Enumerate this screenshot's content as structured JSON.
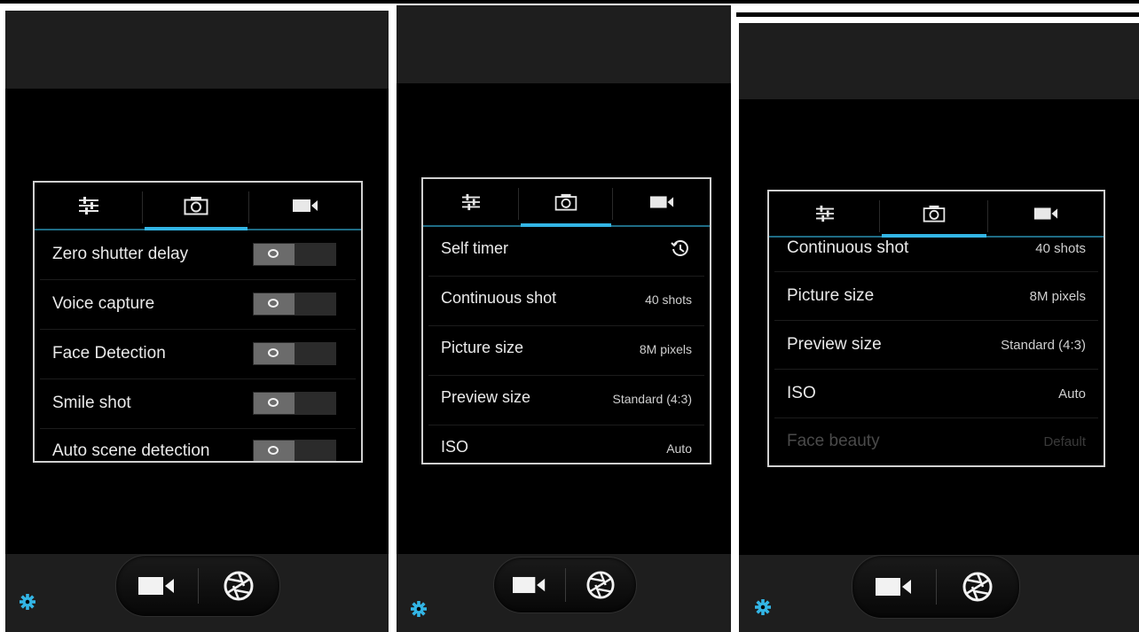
{
  "screens": [
    {
      "tabs": [
        {
          "icon": "settings-sliders-icon"
        },
        {
          "icon": "camera-icon"
        },
        {
          "icon": "video-camera-icon"
        }
      ],
      "active_tab": 1,
      "rows": [
        {
          "label": "Zero shutter delay",
          "toggle": "off"
        },
        {
          "label": "Voice capture",
          "toggle": "off"
        },
        {
          "label": "Face Detection",
          "toggle": "off"
        },
        {
          "label": "Smile shot",
          "toggle": "off"
        },
        {
          "label": "Auto scene detection",
          "toggle": "off"
        }
      ]
    },
    {
      "tabs": [
        {
          "icon": "settings-sliders-icon"
        },
        {
          "icon": "camera-icon"
        },
        {
          "icon": "video-camera-icon"
        }
      ],
      "active_tab": 1,
      "rows": [
        {
          "label": "Self timer",
          "icon": "timer-icon"
        },
        {
          "label": "Continuous shot",
          "value": "40 shots"
        },
        {
          "label": "Picture size",
          "value": "8M pixels"
        },
        {
          "label": "Preview size",
          "value": "Standard (4:3)"
        },
        {
          "label": "ISO",
          "value": "Auto"
        }
      ]
    },
    {
      "tabs": [
        {
          "icon": "settings-sliders-icon"
        },
        {
          "icon": "camera-icon"
        },
        {
          "icon": "video-camera-icon"
        }
      ],
      "active_tab": 1,
      "rows": [
        {
          "label": "Continuous shot",
          "value": "40 shots"
        },
        {
          "label": "Picture size",
          "value": "8M pixels"
        },
        {
          "label": "Preview size",
          "value": "Standard (4:3)"
        },
        {
          "label": "ISO",
          "value": "Auto"
        },
        {
          "label": "Face beauty",
          "value": "Default",
          "disabled": true
        }
      ]
    }
  ],
  "bottom_controls": {
    "settings_icon": "gear-icon",
    "video_icon": "video-camera-icon",
    "shutter_icon": "shutter-icon"
  },
  "colors": {
    "accent": "#33b5e5",
    "gear": "#33b5e5",
    "background": "#000000",
    "bars": "#1e1e1e"
  }
}
